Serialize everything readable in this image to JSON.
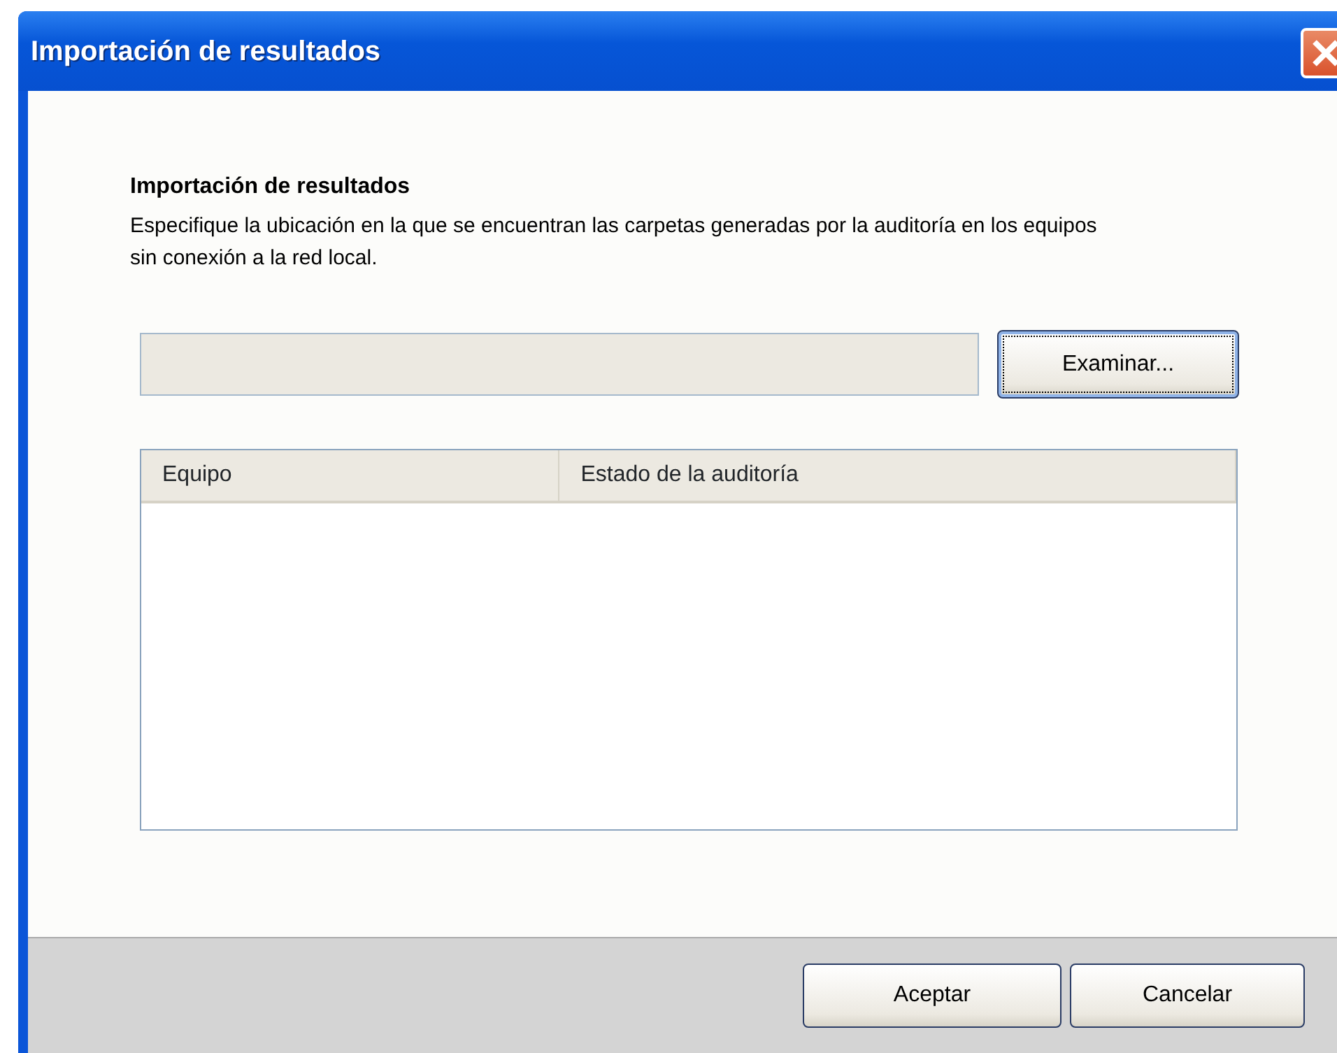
{
  "window": {
    "title": "Importación de resultados"
  },
  "heading": "Importación de resultados",
  "description": "Especifique la ubicación en la que se encuentran las carpetas generadas por la auditoría en los equipos sin conexión a la red local.",
  "path_field": {
    "disabled": true
  },
  "browse_button": {
    "label": "Examinar...",
    "focused": true
  },
  "table": {
    "columns": [
      "Equipo",
      "Estado de la auditoría"
    ]
  },
  "buttons": [
    {
      "label": "Aceptar",
      "focused": false
    },
    {
      "label": "Cancelar",
      "focused": false
    }
  ]
}
